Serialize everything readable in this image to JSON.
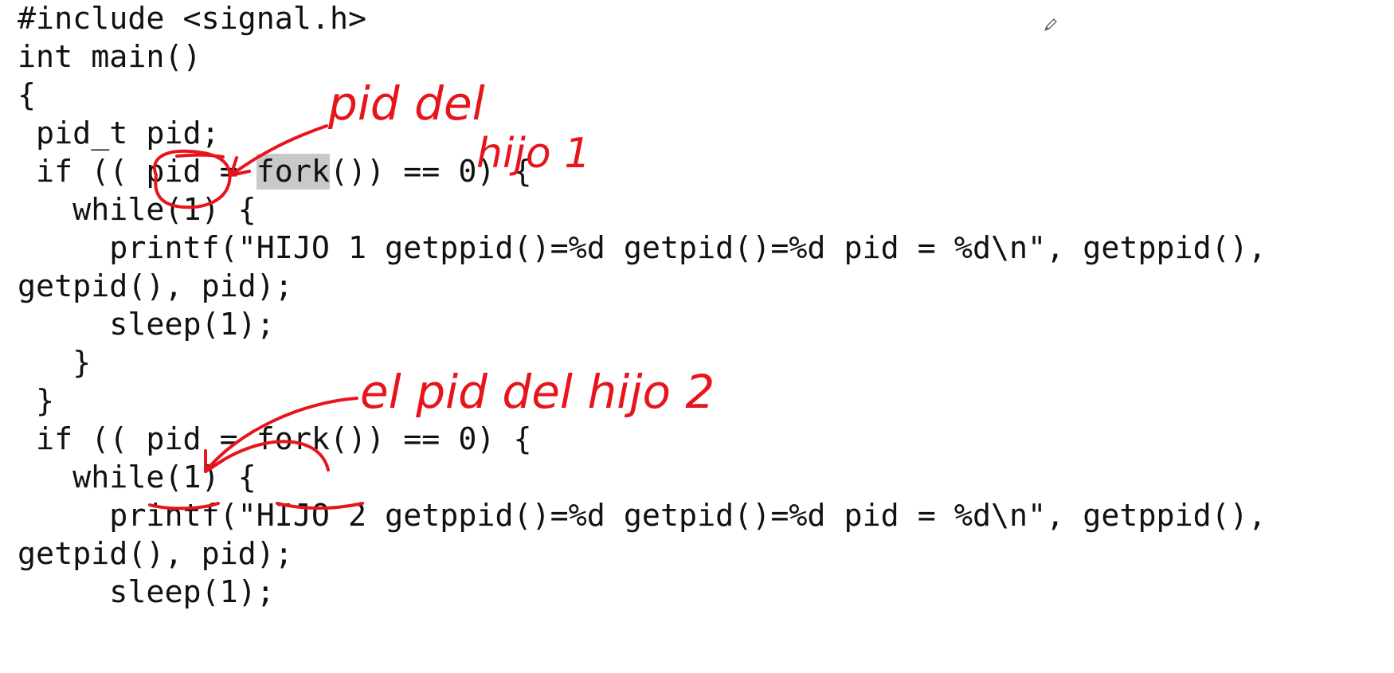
{
  "code": {
    "lines": [
      "#include <signal.h>",
      "int main()",
      "{",
      " pid_t pid;",
      {
        "pre": " if (( pid = ",
        "hl": "fork",
        "post": "()) == 0) {"
      },
      "   while(1) {",
      "     printf(\"HIJO 1 getppid()=%d getpid()=%d pid = %d\\n\", getppid(),",
      "getpid(), pid);",
      "     sleep(1);",
      "   }",
      " }",
      " if (( pid = fork()) == 0) {",
      "   while(1) {",
      "     printf(\"HIJO 2 getppid()=%d getpid()=%d pid = %d\\n\", getppid(),",
      "getpid(), pid);",
      "     sleep(1);"
    ]
  },
  "annotations": {
    "note_1_line1": "pid del",
    "note_1_line2": "hijo 1",
    "note_2": "el pid del hijo 2",
    "ink_color": "#e8141c"
  },
  "icons": {
    "pen": "pencil-icon"
  }
}
